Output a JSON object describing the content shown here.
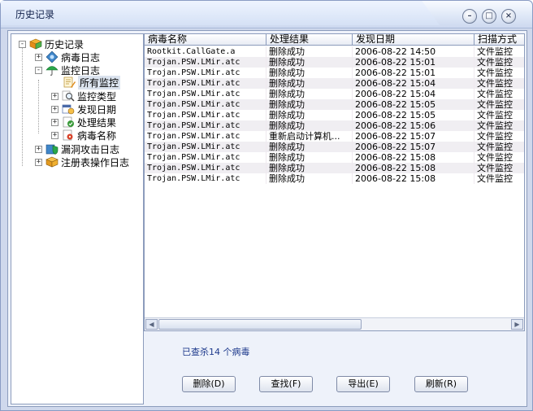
{
  "window": {
    "title": "历史记录"
  },
  "tree": {
    "root": "历史记录",
    "items": [
      {
        "label": "病毒日志",
        "expander": "+"
      },
      {
        "label": "监控日志",
        "expander": "-"
      },
      {
        "label": "所有监控"
      },
      {
        "label": "监控类型",
        "expander": "+"
      },
      {
        "label": "发现日期",
        "expander": "+"
      },
      {
        "label": "处理结果",
        "expander": "+"
      },
      {
        "label": "病毒名称",
        "expander": "+"
      },
      {
        "label": "漏洞攻击日志",
        "expander": "+"
      },
      {
        "label": "注册表操作日志",
        "expander": "+"
      }
    ]
  },
  "table": {
    "columns": [
      "病毒名称",
      "处理结果",
      "发现日期",
      "扫描方式"
    ],
    "rows": [
      [
        "Rootkit.CallGate.a",
        "删除成功",
        "2006-08-22 14:50",
        "文件监控"
      ],
      [
        "Trojan.PSW.LMir.atc",
        "删除成功",
        "2006-08-22 15:01",
        "文件监控"
      ],
      [
        "Trojan.PSW.LMir.atc",
        "删除成功",
        "2006-08-22 15:01",
        "文件监控"
      ],
      [
        "Trojan.PSW.LMir.atc",
        "删除成功",
        "2006-08-22 15:04",
        "文件监控"
      ],
      [
        "Trojan.PSW.LMir.atc",
        "删除成功",
        "2006-08-22 15:04",
        "文件监控"
      ],
      [
        "Trojan.PSW.LMir.atc",
        "删除成功",
        "2006-08-22 15:05",
        "文件监控"
      ],
      [
        "Trojan.PSW.LMir.atc",
        "删除成功",
        "2006-08-22 15:05",
        "文件监控"
      ],
      [
        "Trojan.PSW.LMir.atc",
        "删除成功",
        "2006-08-22 15:06",
        "文件监控"
      ],
      [
        "Trojan.PSW.LMir.atc",
        "重新启动计算机...",
        "2006-08-22 15:07",
        "文件监控"
      ],
      [
        "Trojan.PSW.LMir.atc",
        "删除成功",
        "2006-08-22 15:07",
        "文件监控"
      ],
      [
        "Trojan.PSW.LMir.atc",
        "删除成功",
        "2006-08-22 15:08",
        "文件监控"
      ],
      [
        "Trojan.PSW.LMir.atc",
        "删除成功",
        "2006-08-22 15:08",
        "文件监控"
      ],
      [
        "Trojan.PSW.LMir.atc",
        "删除成功",
        "2006-08-22 15:08",
        "文件监控"
      ]
    ]
  },
  "status": {
    "text": "已查杀14 个病毒"
  },
  "buttons": {
    "delete": "删除(D)",
    "find": "查找(F)",
    "export": "导出(E)",
    "refresh": "刷新(R)"
  },
  "colors": {
    "accent": "#1e3a8c",
    "frame": "#cfd8ec",
    "selected": "#dbe3ee"
  }
}
